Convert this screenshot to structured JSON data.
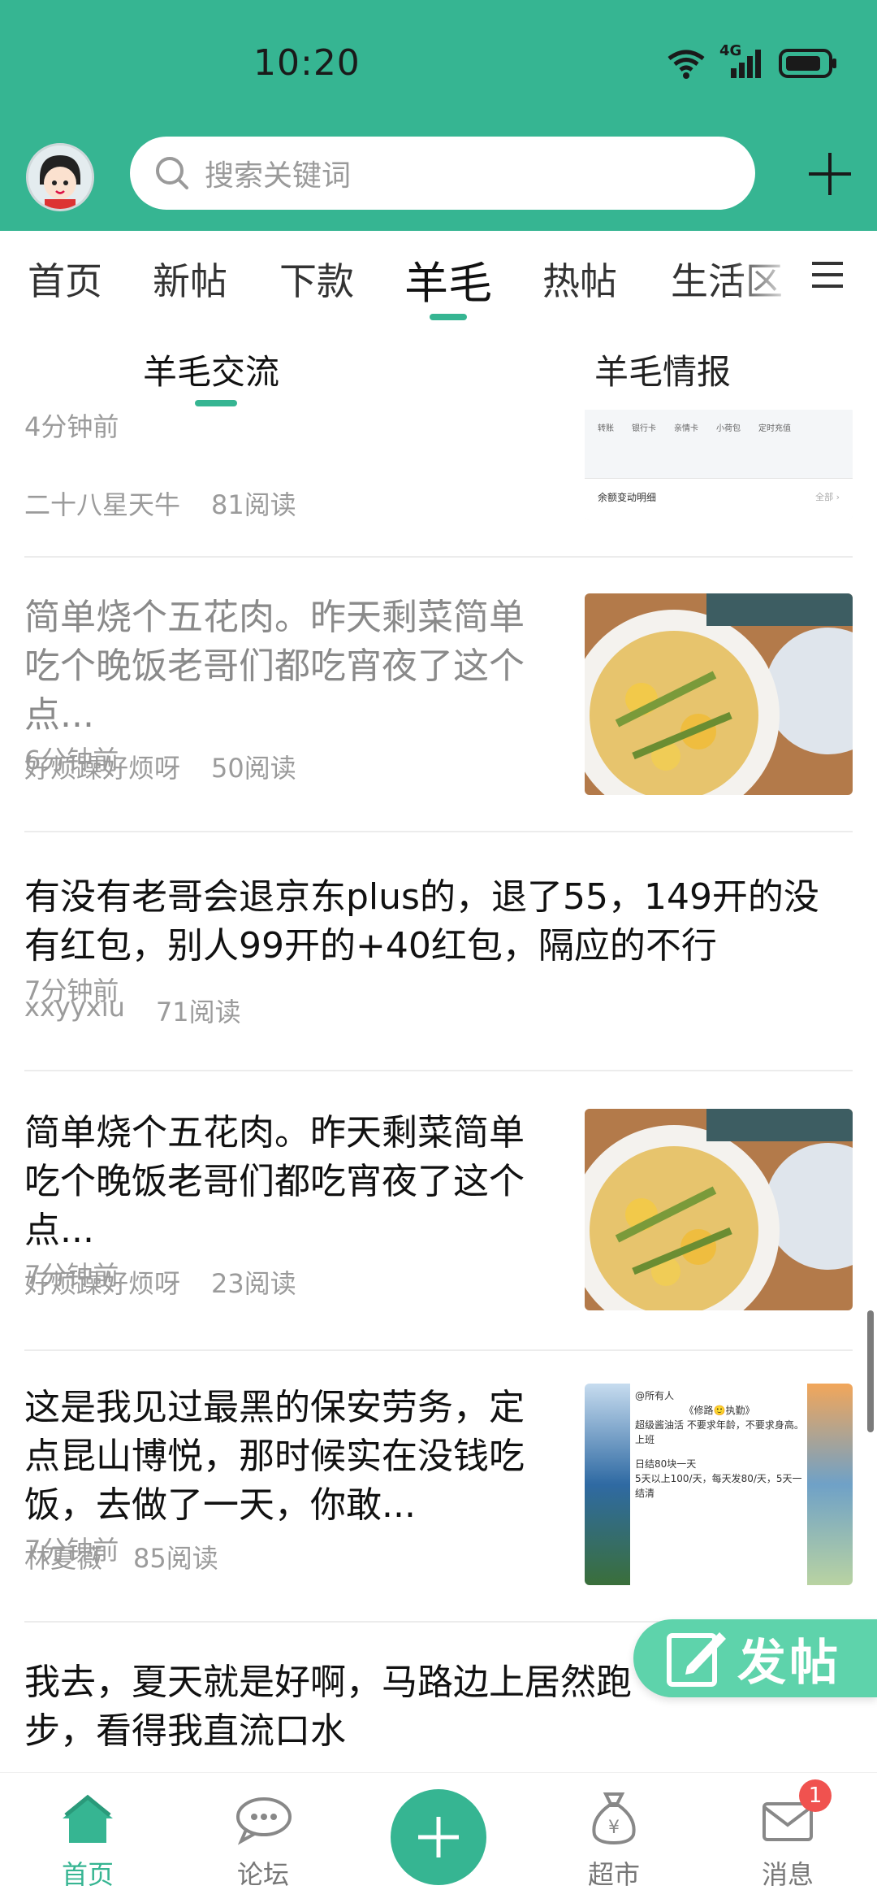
{
  "status_bar": {
    "time": "10:20",
    "network": "4G"
  },
  "search": {
    "placeholder": "搜索关键词"
  },
  "category_tabs": [
    "首页",
    "新帖",
    "下款",
    "羊毛",
    "热帖",
    "生活区"
  ],
  "active_category": "羊毛",
  "sub_tabs": [
    "羊毛交流",
    "羊毛情报"
  ],
  "active_sub_tab": "羊毛交流",
  "feed": [
    {
      "author": "二十八星天牛",
      "views": "81阅读",
      "time": "4分钟前",
      "thumb_text": [
        "转账",
        "银行卡",
        "亲情卡",
        "小荷包",
        "定时充值",
        "余额变动明细",
        "全部 ›"
      ]
    },
    {
      "title": "简单烧个五花肉。昨天剩菜简单吃个晚饭老哥们都吃宵夜了这个点...",
      "author": "好烦躁好烦呀",
      "views": "50阅读",
      "time": "6分钟前",
      "read": true
    },
    {
      "title": "有没有老哥会退京东plus的，退了55，149开的没有红包，别人99开的+40红包，隔应的不行",
      "author": "xxyyxiu",
      "views": "71阅读",
      "time": "7分钟前"
    },
    {
      "title": "简单烧个五花肉。昨天剩菜简单吃个晚饭老哥们都吃宵夜了这个点...",
      "author": "好烦躁好烦呀",
      "views": "23阅读",
      "time": "7分钟前"
    },
    {
      "title": "这是我见过最黑的保安劳务，定点昆山博悦，那时候实在没钱吃饭，去做了一天，你敢...",
      "author": "林夏薇",
      "views": "85阅读",
      "time": "7分钟前",
      "thumb_text": [
        "@所有人",
        "《修路🙂执勤》",
        "超级酱油活  不要求年龄，不要求身高。",
        "上班",
        "日结80块一天",
        "5天以上100/天，每天发80/天，5天一结清"
      ]
    },
    {
      "title": "我去，夏天就是好啊，马路边上居然跑步，看得我直流口水"
    }
  ],
  "fab_label": "发帖",
  "bottom_nav": [
    "首页",
    "论坛",
    "超市",
    "消息"
  ],
  "active_nav": "首页",
  "message_badge": "1",
  "colors": {
    "primary": "#36b592",
    "fab": "#5ed3ab",
    "badge": "#f0524f"
  }
}
